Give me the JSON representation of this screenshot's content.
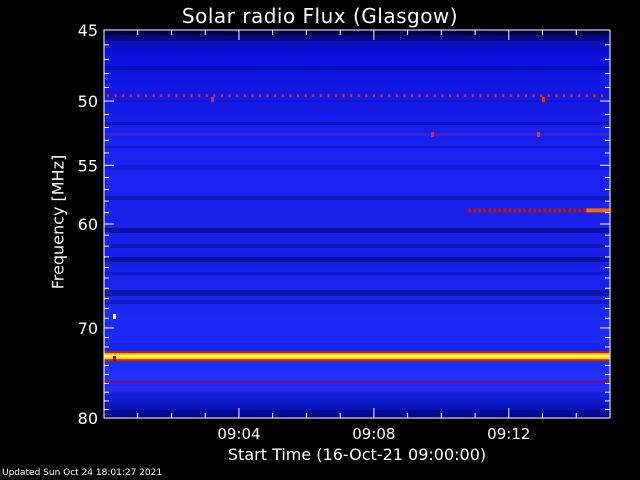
{
  "chart_data": {
    "type": "heatmap",
    "title": "Solar radio Flux (Glasgow)",
    "xlabel": "Start Time (16-Oct-21 09:00:00)",
    "ylabel": "Frequency [MHz]",
    "x_range_minutes": [
      0,
      15.0
    ],
    "x_ticks": [
      "09:04",
      "09:08",
      "09:12"
    ],
    "x_tick_minutes": [
      4,
      8,
      12
    ],
    "y_range_mhz": [
      45,
      80
    ],
    "y_scale": "log",
    "y_ticks": [
      45,
      50,
      55,
      60,
      70,
      80
    ],
    "y_tick_labels": [
      "45",
      "50",
      "55",
      "60",
      "70",
      "80"
    ],
    "colormap": [
      "#000033",
      "#0000cc",
      "#2a3cff",
      "#aa0000",
      "#ff2a00",
      "#ffcc00",
      "#ffffff"
    ],
    "features": [
      {
        "kind": "continuous_band",
        "freq_mhz": 73.0,
        "intensity": "high",
        "color": "#ffff88"
      },
      {
        "kind": "dotted_band",
        "freq_mhz": 49.6,
        "intensity": "medium",
        "color": "#ff2200"
      },
      {
        "kind": "intermittent_band",
        "freq_mhz": 58.8,
        "start_minute": 10.8,
        "end_minute": 15.0,
        "intensity": "medium-high",
        "color": "#ff6600"
      },
      {
        "kind": "faint_band",
        "freq_mhz": 75.8,
        "intensity": "low",
        "color": "#aa0033"
      }
    ]
  },
  "footer_text": "Updated Sun Oct 24 18:01:27 2021"
}
